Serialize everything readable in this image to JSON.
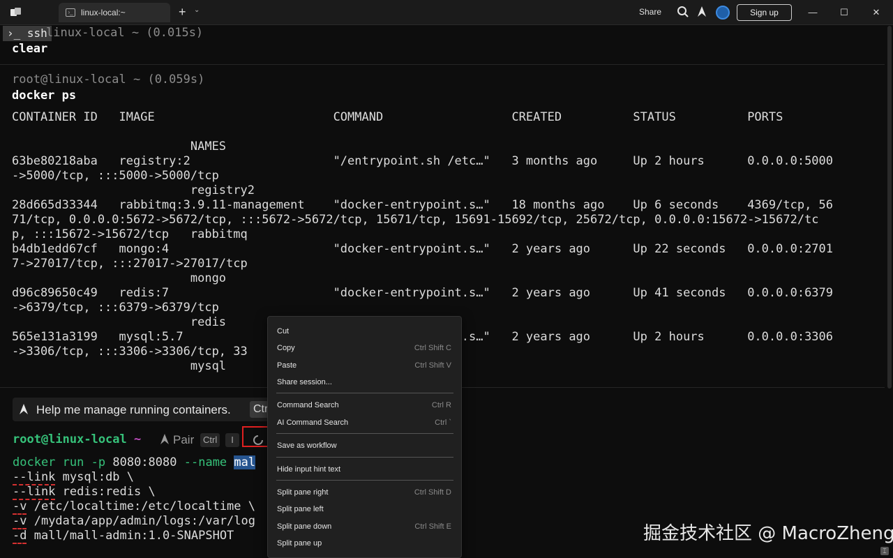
{
  "window": {
    "tab_title": "linux-local:~",
    "share_label": "Share",
    "signup_label": "Sign up",
    "new_tab": "+",
    "minimize": "—",
    "maximize": "☐",
    "close": "✕"
  },
  "blocks": [
    {
      "badge": "ssh",
      "header": "linux-local ~ (0.015s)",
      "command": "clear"
    },
    {
      "header": "root@linux-local ~ (0.059s)",
      "command": "docker ps"
    }
  ],
  "docker_output": [
    "CONTAINER ID   IMAGE                         COMMAND                  CREATED          STATUS          PORTS",
    "",
    "                         NAMES",
    "63be80218aba   registry:2                    \"/entrypoint.sh /etc…\"   3 months ago     Up 2 hours      0.0.0.0:5000",
    "->5000/tcp, :::5000->5000/tcp",
    "                         registry2",
    "28d665d33344   rabbitmq:3.9.11-management    \"docker-entrypoint.s…\"   18 months ago    Up 6 seconds    4369/tcp, 56",
    "71/tcp, 0.0.0.0:5672->5672/tcp, :::5672->5672/tcp, 15671/tcp, 15691-15692/tcp, 25672/tcp, 0.0.0.0:15672->15672/tc",
    "p, :::15672->15672/tcp   rabbitmq",
    "b4db1edd67cf   mongo:4                       \"docker-entrypoint.s…\"   2 years ago      Up 22 seconds   0.0.0.0:2701",
    "7->27017/tcp, :::27017->27017/tcp",
    "                         mongo",
    "d96c89650c49   redis:7                       \"docker-entrypoint.s…\"   2 years ago      Up 41 seconds   0.0.0.0:6379",
    "->6379/tcp, :::6379->6379/tcp",
    "                         redis",
    "565e131a3199   mysql:5.7                     \"docker-entrypoint.s…\"   2 years ago      Up 2 hours      0.0.0.0:3306",
    "->3306/tcp, :::3306->3306/tcp, 33",
    "                         mysql"
  ],
  "ai_hint": {
    "text": "Help me manage running containers.",
    "key": "Ctr"
  },
  "prompt": {
    "user_host": "root@linux-local",
    "dir": "~",
    "pair_label": "Pair",
    "key_ctrl": "Ctrl",
    "key_i": "I"
  },
  "command_input": {
    "line1_cmd": "docker",
    "line1_sub": "run",
    "line1_flag": "-p",
    "line1_arg": "8080:8080",
    "line1_flag2": "--name",
    "line1_selected": "mal",
    "line2_flag": "--link",
    "line2_rest": " mysql:db \\",
    "line3_flag": "--link",
    "line3_rest": " redis:redis \\",
    "line4_flag": "-v",
    "line4_rest": " /etc/localtime:/etc/localtime \\",
    "line5_flag": "-v",
    "line5_rest": " /mydata/app/admin/logs:/var/log",
    "line6_flag": "-d",
    "line6_rest": " mall/mall-admin:1.0-SNAPSHOT"
  },
  "context_menu": {
    "items": [
      {
        "label": "Cut",
        "shortcut": ""
      },
      {
        "label": "Copy",
        "shortcut": "Ctrl Shift C"
      },
      {
        "label": "Paste",
        "shortcut": "Ctrl Shift V"
      },
      {
        "label": "Share session...",
        "shortcut": ""
      },
      {
        "label": "Command Search",
        "shortcut": "Ctrl R"
      },
      {
        "label": "AI Command Search",
        "shortcut": "Ctrl `"
      },
      {
        "label": "Save as workflow",
        "shortcut": ""
      },
      {
        "label": "Hide input hint text",
        "shortcut": ""
      },
      {
        "label": "Split pane right",
        "shortcut": "Ctrl Shift D"
      },
      {
        "label": "Split pane left",
        "shortcut": ""
      },
      {
        "label": "Split pane down",
        "shortcut": "Ctrl Shift E"
      },
      {
        "label": "Split pane up",
        "shortcut": ""
      }
    ]
  },
  "watermark": "掘金技术社区 @ MacroZheng",
  "colors": {
    "prompt_green": "#36c27a",
    "selection": "#26548f",
    "highlight_box": "#e02020"
  }
}
